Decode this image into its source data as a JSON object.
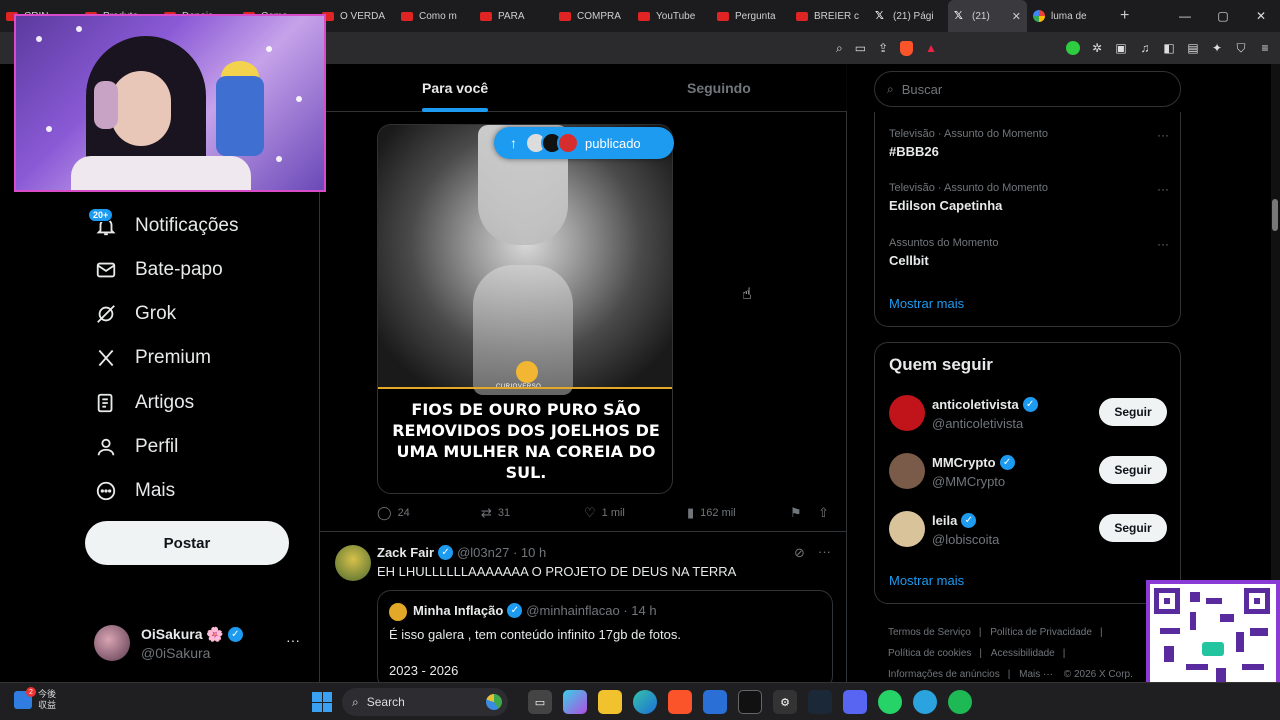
{
  "browser": {
    "tabs": [
      {
        "label": "CRIN",
        "type": "yt"
      },
      {
        "label": "Produto",
        "type": "yt"
      },
      {
        "label": "Depois",
        "type": "yt"
      },
      {
        "label": "Como",
        "type": "yt"
      },
      {
        "label": "O VERDA",
        "type": "yt"
      },
      {
        "label": "Como m",
        "type": "yt"
      },
      {
        "label": "PARA",
        "type": "yt"
      },
      {
        "label": "COMPRA",
        "type": "yt"
      },
      {
        "label": "YouTube",
        "type": "yt"
      },
      {
        "label": "Pergunta",
        "type": "yt"
      },
      {
        "label": "BREIER c",
        "type": "yt"
      },
      {
        "label": "(21) Pági",
        "type": "x"
      },
      {
        "label": "(21)",
        "type": "x",
        "active": true
      },
      {
        "label": "luma de",
        "type": "g"
      }
    ],
    "new_tab": "+",
    "window_controls": {
      "minimize": "—",
      "maximize": "▢",
      "close": "✕"
    }
  },
  "sidebar": {
    "notif_badge": "20+",
    "items": [
      {
        "label": "Notificações",
        "icon": "bell-icon"
      },
      {
        "label": "Bate-papo",
        "icon": "mail-icon"
      },
      {
        "label": "Grok",
        "icon": "grok-icon"
      },
      {
        "label": "Premium",
        "icon": "x-logo-icon"
      },
      {
        "label": "Artigos",
        "icon": "article-icon"
      },
      {
        "label": "Perfil",
        "icon": "person-icon"
      },
      {
        "label": "Mais",
        "icon": "more-circle-icon"
      }
    ],
    "post_button": "Postar",
    "account": {
      "name": "OiSakura 🌸",
      "handle": "@0iSakura",
      "more": "···"
    }
  },
  "main": {
    "tabs": {
      "for_you": "Para você",
      "following": "Seguindo"
    },
    "new_posts_pill": "publicado",
    "media": {
      "logo_text": "CURIOVERSO",
      "headline": "FIOS DE OURO PURO SÃO REMOVIDOS DOS JOELHOS DE UMA MULHER NA COREIA DO SUL."
    },
    "actions": {
      "replies": "24",
      "reposts": "31",
      "likes": "1 mil",
      "views": "162 mil"
    },
    "tweet2": {
      "name": "Zack Fair",
      "meta": "@l03n27 · 10 h",
      "text": "EH LHULLLLLLAAAAAAA O PROJETO DE DEUS NA TERRA",
      "quote": {
        "name": "Minha Inflação",
        "meta": "@minhainflacao · 14 h",
        "text": "É isso galera , tem conteúdo infinito 17gb de fotos.",
        "text2": "2023 - 2026"
      }
    }
  },
  "right": {
    "search_placeholder": "Buscar",
    "trends": [
      {
        "category": "Televisão · Assunto do Momento",
        "title": "#BBB26"
      },
      {
        "category": "Televisão · Assunto do Momento",
        "title": "Edilson Capetinha"
      },
      {
        "category": "Assuntos do Momento",
        "title": "Cellbit"
      }
    ],
    "trends_more": "Mostrar mais",
    "who_to_follow": {
      "title": "Quem seguir",
      "people": [
        {
          "name": "anticoletivista",
          "handle": "@anticoletivista",
          "button": "Seguir",
          "color": "#c0141a"
        },
        {
          "name": "MMCrypto",
          "handle": "@MMCrypto",
          "button": "Seguir",
          "color": "#7a5a48"
        },
        {
          "name": "leila",
          "handle": "@lobiscoita",
          "button": "Seguir",
          "color": "#d9c39a"
        }
      ],
      "more": "Mostrar mais"
    },
    "footer": {
      "links": [
        "Termos de Serviço",
        "Política de Privacidade",
        "Política de cookies",
        "Acessibilidade",
        "Informações de anúncios",
        "Mais ···"
      ],
      "copyright": "© 2026 X Corp."
    }
  },
  "taskbar": {
    "widget_line1": "今後",
    "widget_line2": "収益",
    "widget_badge": "2",
    "search": "Search"
  },
  "colors": {
    "accent": "#1d9bf0",
    "background": "#000000",
    "muted": "#71767b"
  }
}
